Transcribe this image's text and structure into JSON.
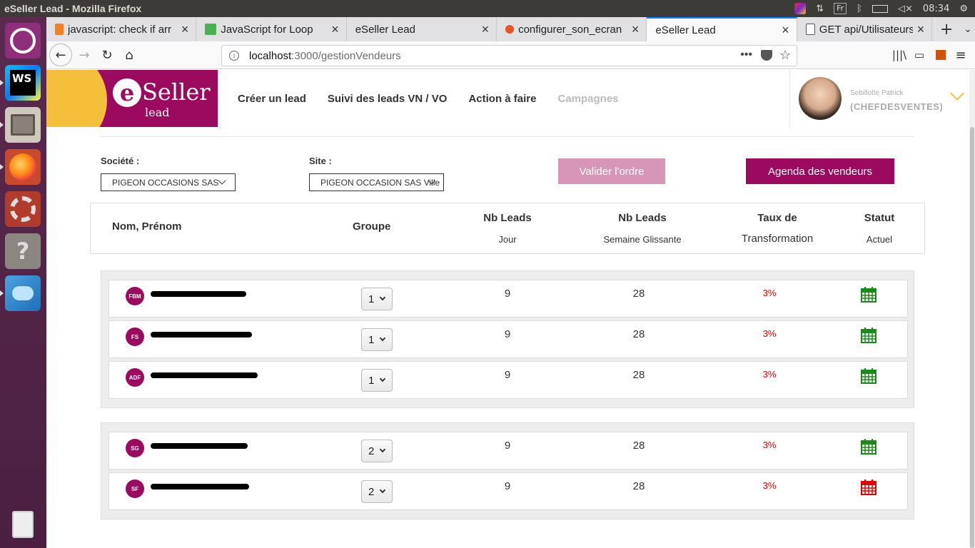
{
  "os": {
    "window_title": "eSeller Lead - Mozilla Firefox",
    "keyboard": "Fr",
    "clock": "08:34"
  },
  "browser": {
    "tabs": [
      {
        "label": "javascript: check if arr",
        "favicon": "stackoverflow-icon",
        "active": false
      },
      {
        "label": "JavaScript for Loop",
        "favicon": "w3schools-icon",
        "active": false
      },
      {
        "label": "eSeller Lead",
        "favicon": "none",
        "active": false
      },
      {
        "label": "configurer_son_ecran",
        "favicon": "ubuntu-icon",
        "active": false
      },
      {
        "label": "eSeller Lead",
        "favicon": "none",
        "active": true
      },
      {
        "label": "GET api/Utilisateurs?c",
        "favicon": "page-icon",
        "active": false
      }
    ],
    "url_host": "localhost",
    "url_path": ":3000/gestionVendeurs"
  },
  "app": {
    "brand_main": "Seller",
    "brand_e": "e",
    "brand_sub": "lead",
    "nav": [
      {
        "label": "Créer un lead",
        "enabled": true
      },
      {
        "label": "Suivi des leads VN / VO",
        "enabled": true
      },
      {
        "label": "Action à faire",
        "enabled": true
      },
      {
        "label": "Campagnes",
        "enabled": false
      }
    ],
    "user": {
      "name": "Sebillotte Patrick",
      "role": "(CHEFDESVENTES)"
    },
    "colors": {
      "brand": "#9b0a5e",
      "accent": "#f4bf3b",
      "danger": "#e00000",
      "success": "#1a8a1a"
    }
  },
  "filters": {
    "societe_label": "Société :",
    "societe_value": "PIGEON OCCASIONS SAS",
    "site_label": "Site :",
    "site_value": "PIGEON OCCASION SAS Ville",
    "validate_label": "Valider l'ordre",
    "agenda_label": "Agenda des vendeurs"
  },
  "table": {
    "headers": {
      "name": "Nom, Prénom",
      "group": "Groupe",
      "leads_day": "Nb Leads",
      "leads_day_sub": "Jour",
      "leads_week": "Nb Leads",
      "leads_week_sub": "Semaine Glissante",
      "rate": "Taux de",
      "rate_sub": "Transformation",
      "status": "Statut",
      "status_sub": "Actuel"
    },
    "groups": [
      {
        "rows": [
          {
            "initials": "FBM",
            "name_redacted": true,
            "group": "1",
            "leads_day": "9",
            "leads_week": "28",
            "rate": "3%",
            "status": "available"
          },
          {
            "initials": "FS",
            "name_redacted": true,
            "group": "1",
            "leads_day": "9",
            "leads_week": "28",
            "rate": "3%",
            "status": "available"
          },
          {
            "initials": "ADF",
            "name_redacted": true,
            "group": "1",
            "leads_day": "9",
            "leads_week": "28",
            "rate": "3%",
            "status": "available"
          }
        ]
      },
      {
        "rows": [
          {
            "initials": "SG",
            "name_redacted": true,
            "group": "2",
            "leads_day": "9",
            "leads_week": "28",
            "rate": "3%",
            "status": "available"
          },
          {
            "initials": "SF",
            "name_redacted": true,
            "group": "2",
            "leads_day": "9",
            "leads_week": "28",
            "rate": "3%",
            "status": "unavailable"
          }
        ]
      }
    ]
  }
}
